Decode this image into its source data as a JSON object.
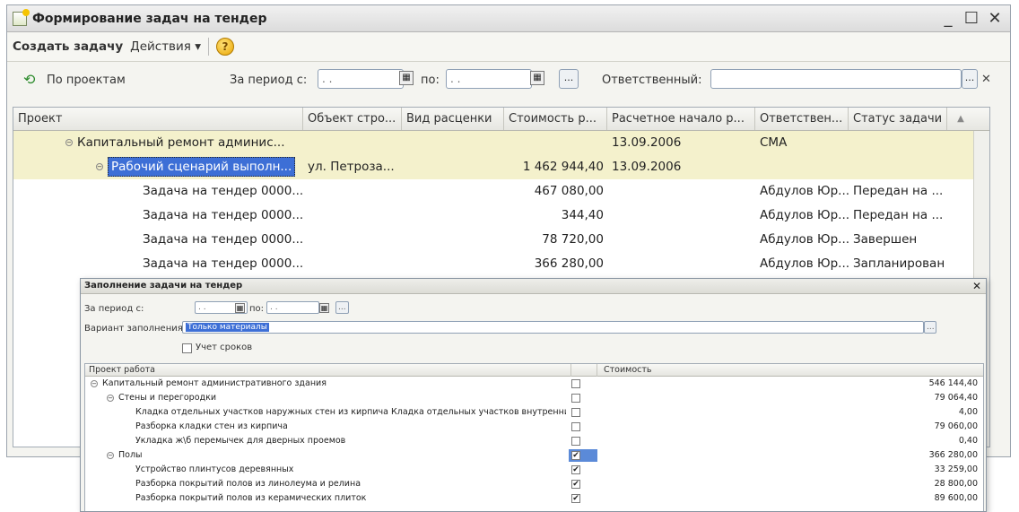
{
  "window": {
    "title": "Формирование задач на тендер"
  },
  "toolbar": {
    "create_label": "Создать задачу",
    "actions_label": "Действия ▾",
    "help_label": "?"
  },
  "filter": {
    "by_projects": "По проектам",
    "period_from_label": "За период с:",
    "period_from_value": " .  .",
    "period_to_label": "по:",
    "period_to_value": " .  .",
    "ellipsis": "...",
    "responsible_label": "Ответственный:",
    "responsible_value": ""
  },
  "grid": {
    "columns": [
      "Проект",
      "Объект стро...",
      "Вид расценки",
      "Стоимость р...",
      "Расчетное начало р...",
      "Ответствен...",
      "Статус задачи"
    ],
    "rows": [
      {
        "project": "Капитальный ремонт админис...",
        "object": "",
        "kind": "",
        "cost": "",
        "start": "13.09.2006",
        "resp": "СМА",
        "status": ""
      },
      {
        "project": "Рабочий сценарий выполн...",
        "object": "ул. Петроза...",
        "kind": "",
        "cost": "1 462 944,40",
        "start": "13.09.2006",
        "resp": "",
        "status": ""
      },
      {
        "project": "Задача на тендер 0000...",
        "object": "",
        "kind": "",
        "cost": "467 080,00",
        "start": "",
        "resp": "Абдулов Юр...",
        "status": "Передан на ..."
      },
      {
        "project": "Задача на тендер 0000...",
        "object": "",
        "kind": "",
        "cost": "344,40",
        "start": "",
        "resp": "Абдулов Юр...",
        "status": "Передан на ..."
      },
      {
        "project": "Задача на тендер 0000...",
        "object": "",
        "kind": "",
        "cost": "78 720,00",
        "start": "",
        "resp": "Абдулов Юр...",
        "status": "Завершен"
      },
      {
        "project": "Задача на тендер 0000...",
        "object": "",
        "kind": "",
        "cost": "366 280,00",
        "start": "",
        "resp": "Абдулов Юр...",
        "status": "Запланирован"
      }
    ]
  },
  "dialog": {
    "title": "Заполнение задачи на тендер",
    "period_from_label": "За период с:",
    "period_from_value": " .  .",
    "period_to_label": "по:",
    "period_to_value": " .  .",
    "ellipsis": "...",
    "variant_label": "Вариант заполнения:",
    "variant_value": "Только материалы",
    "deadline_label": "Учет сроков",
    "col_project": "Проект работа",
    "col_cost": "Стоимость",
    "rows": [
      {
        "name": "Капитальный ремонт административного здания",
        "value": "546 144,40",
        "checked": "",
        "indent": 0,
        "group": true
      },
      {
        "name": "Стены и перегородки",
        "value": "79 064,40",
        "checked": "",
        "indent": 1,
        "group": true
      },
      {
        "name": "Кладка отдельных участков наружных стен из кирпича Кладка отдельных участков внутренних стен из ...",
        "value": "4,00",
        "checked": "",
        "indent": 2,
        "group": false
      },
      {
        "name": "Разборка кладки стен из кирпича",
        "value": "79 060,00",
        "checked": "",
        "indent": 2,
        "group": false
      },
      {
        "name": "Укладка ж\\б перемычек для дверных проемов",
        "value": "0,40",
        "checked": "",
        "indent": 2,
        "group": false
      },
      {
        "name": "Полы",
        "value": "366 280,00",
        "checked": "✔",
        "indent": 1,
        "group": true
      },
      {
        "name": "Устройство плинтусов деревянных",
        "value": "33 259,00",
        "checked": "✔",
        "indent": 2,
        "group": false
      },
      {
        "name": "Разборка покрытий полов из линолеума и релина",
        "value": "28 800,00",
        "checked": "✔",
        "indent": 2,
        "group": false
      },
      {
        "name": "Разборка покрытий полов из керамических плиток",
        "value": "89 600,00",
        "checked": "✔",
        "indent": 2,
        "group": false
      }
    ]
  }
}
